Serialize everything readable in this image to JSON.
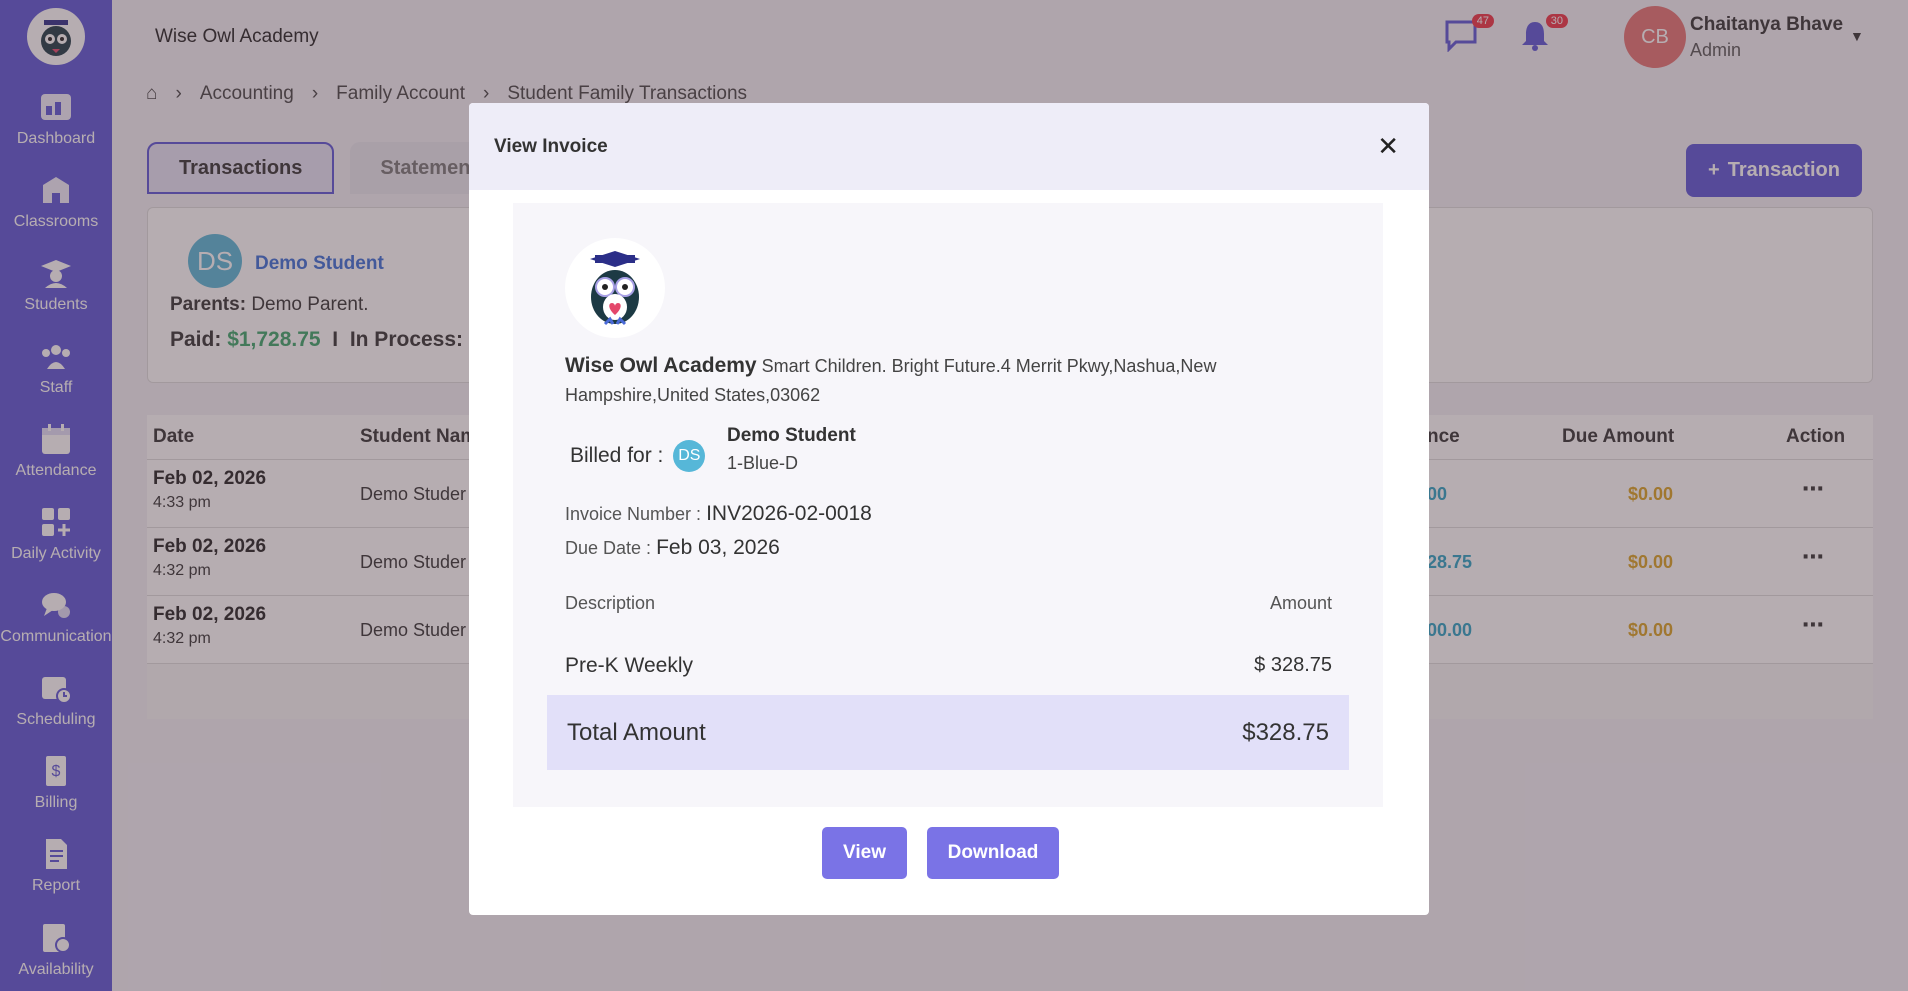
{
  "app": {
    "title": "Wise Owl Academy"
  },
  "sidebar": {
    "items": [
      {
        "label": "Dashboard",
        "icon": "dashboard-icon"
      },
      {
        "label": "Classrooms",
        "icon": "classroom-icon"
      },
      {
        "label": "Students",
        "icon": "student-icon"
      },
      {
        "label": "Staff",
        "icon": "staff-icon"
      },
      {
        "label": "Attendance",
        "icon": "attendance-icon"
      },
      {
        "label": "Daily Activity",
        "icon": "daily-activity-icon"
      },
      {
        "label": "Communication",
        "icon": "communication-icon"
      },
      {
        "label": "Scheduling",
        "icon": "scheduling-icon"
      },
      {
        "label": "Billing",
        "icon": "billing-icon"
      },
      {
        "label": "Report",
        "icon": "report-icon"
      },
      {
        "label": "Availability",
        "icon": "availability-icon"
      }
    ]
  },
  "header": {
    "messages_count": "47",
    "notifications_count": "30",
    "user": {
      "initials": "CB",
      "name": "Chaitanya Bhave",
      "role": "Admin"
    }
  },
  "breadcrumb": [
    "Accounting",
    "Family Account",
    "Student Family Transactions"
  ],
  "tabs": [
    "Transactions",
    "Statement"
  ],
  "add_transaction_label": "Transaction",
  "summary": {
    "initials": "DS",
    "student": "Demo Student",
    "parents_label": "Parents:",
    "parents_value": "Demo Parent.",
    "paid_label": "Paid:",
    "paid_value": "$1,728.75",
    "separator": "I",
    "in_process_label": "In Process:"
  },
  "table": {
    "headers": {
      "date": "Date",
      "student": "Student Nam",
      "balance": "nce",
      "due": "Due Amount",
      "action": "Action"
    },
    "rows": [
      {
        "date": "Feb 02, 2026",
        "time": "4:33 pm",
        "student": "Demo Studer",
        "balance": "00",
        "due": "$0.00"
      },
      {
        "date": "Feb 02, 2026",
        "time": "4:32 pm",
        "student": "Demo Studer",
        "balance": "28.75",
        "due": "$0.00"
      },
      {
        "date": "Feb 02, 2026",
        "time": "4:32 pm",
        "student": "Demo Studer",
        "balance": "00.00",
        "due": "$0.00"
      }
    ]
  },
  "modal": {
    "title": "View Invoice",
    "school_name": "Wise Owl Academy",
    "school_address": "Smart Children. Bright Future.4 Merrit Pkwy,Nashua,New Hampshire,United States,03062",
    "billed_for_label": "Billed for :",
    "billed_initials": "DS",
    "billed_name": "Demo Student",
    "billed_class": "1-Blue-D",
    "invoice_number_label": "Invoice Number :",
    "invoice_number": "INV2026-02-0018",
    "due_date_label": "Due Date :",
    "due_date": "Feb 03, 2026",
    "description_header": "Description",
    "amount_header": "Amount",
    "line_item": {
      "description": "Pre-K Weekly",
      "amount": "$ 328.75"
    },
    "total_label": "Total Amount",
    "total_value": "$328.75",
    "view_label": "View",
    "download_label": "Download"
  }
}
